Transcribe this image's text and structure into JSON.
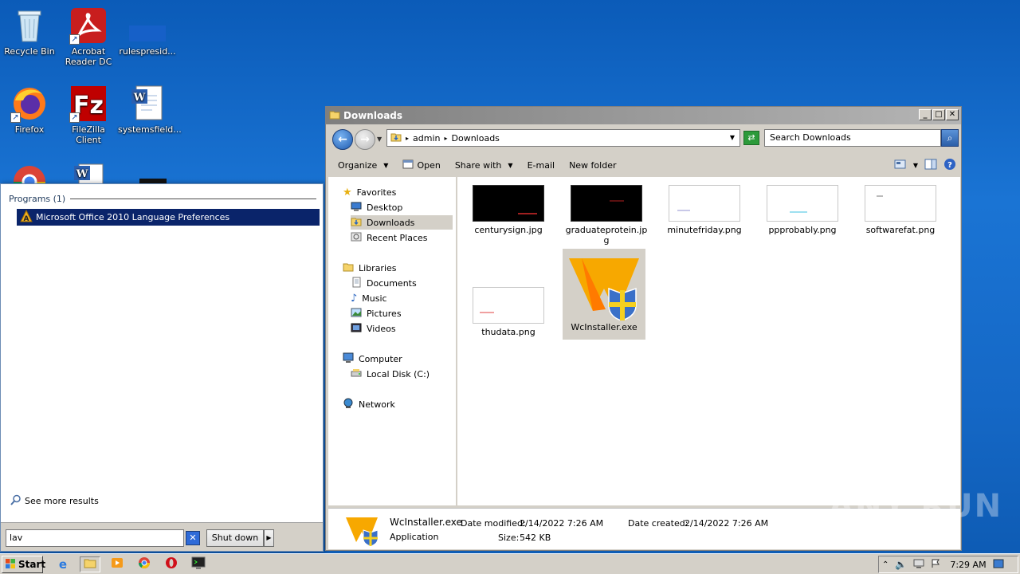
{
  "desktop": {
    "icons": [
      {
        "label": "Recycle Bin",
        "icon": "recycle-bin-icon"
      },
      {
        "label": "Acrobat Reader DC",
        "icon": "acrobat-icon"
      },
      {
        "label": "rulespresid...",
        "icon": "file-icon"
      },
      {
        "label": "Firefox",
        "icon": "firefox-icon"
      },
      {
        "label": "FileZilla Client",
        "icon": "filezilla-icon"
      },
      {
        "label": "systemsfield...",
        "icon": "word-icon"
      }
    ]
  },
  "start_menu": {
    "section_title": "Programs (1)",
    "result": "Microsoft Office 2010 Language Preferences",
    "see_more": "See more results",
    "search_value": "lav",
    "shutdown_label": "Shut down"
  },
  "explorer": {
    "title": "Downloads",
    "breadcrumb": [
      "admin",
      "Downloads"
    ],
    "search_placeholder": "Search Downloads",
    "toolbar": {
      "organize": "Organize",
      "open": "Open",
      "share_with": "Share with",
      "email": "E-mail",
      "new_folder": "New folder"
    },
    "nav": {
      "favorites": "Favorites",
      "desktop": "Desktop",
      "downloads": "Downloads",
      "recent": "Recent Places",
      "libraries": "Libraries",
      "documents": "Documents",
      "music": "Music",
      "pictures": "Pictures",
      "videos": "Videos",
      "computer": "Computer",
      "local_disk": "Local Disk (C:)",
      "network": "Network"
    },
    "files": [
      {
        "name": "centurysign.jpg"
      },
      {
        "name": "graduateprotein.jpg"
      },
      {
        "name": "minutefriday.png"
      },
      {
        "name": "ppprobably.png"
      },
      {
        "name": "softwarefat.png"
      },
      {
        "name": "thudata.png"
      },
      {
        "name": "WcInstaller.exe"
      }
    ],
    "details": {
      "name": "WcInstaller.exe",
      "type": "Application",
      "modified_label": "Date modified:",
      "modified": "2/14/2022 7:26 AM",
      "created_label": "Date created:",
      "created": "2/14/2022 7:26 AM",
      "size_label": "Size:",
      "size": "542 KB"
    }
  },
  "taskbar": {
    "start": "Start",
    "clock": "7:29 AM"
  },
  "watermark": "ANY RUN",
  "colors": {
    "desktop_blue": "#1568c6",
    "selection_navy": "#0a246a",
    "chrome_gray": "#d4d0c8"
  }
}
